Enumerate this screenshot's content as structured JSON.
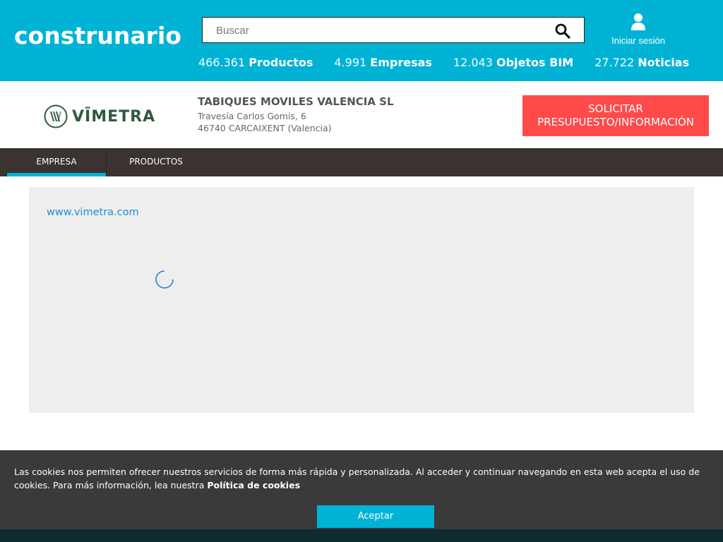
{
  "header": {
    "logo": "construnario",
    "search_placeholder": "Buscar",
    "login_label": "Iniciar sesión",
    "stats": [
      {
        "num": "466.361",
        "label": "Productos"
      },
      {
        "num": "4.991",
        "label": "Empresas"
      },
      {
        "num": "12.043",
        "label": "Objetos BIM"
      },
      {
        "num": "27.722",
        "label": "Noticias"
      }
    ]
  },
  "company": {
    "logo_text": "VĪMETRA",
    "name": "TABIQUES MOVILES VALENCIA SL",
    "address1": "Travesía Carlos Gomis, 6",
    "address2": "46740 CARCAIXENT (Valencia)",
    "quote_line1": "SOLICITAR",
    "quote_line2": "PRESUPUESTO/INFORMACIÓN"
  },
  "tabs": [
    {
      "label": "EMPRESA",
      "active": true
    },
    {
      "label": "PRODUCTOS",
      "active": false
    }
  ],
  "content": {
    "website": "www.vimetra.com"
  },
  "cookies": {
    "text": "Las cookies nos permiten ofrecer nuestros servicios de forma más rápida y personalizada. Al acceder y continuar navegando en esta web acepta el uso de cookies. Para más información, lea nuestra",
    "policy_link": "Política de cookies",
    "accept": "Aceptar"
  },
  "colors": {
    "brand": "#00b3d4",
    "cta": "#ff4a4a",
    "tabbar": "#3a3331",
    "link": "#1a8ed0"
  },
  "icons": [
    "search-icon",
    "user-icon",
    "spinner-icon"
  ]
}
